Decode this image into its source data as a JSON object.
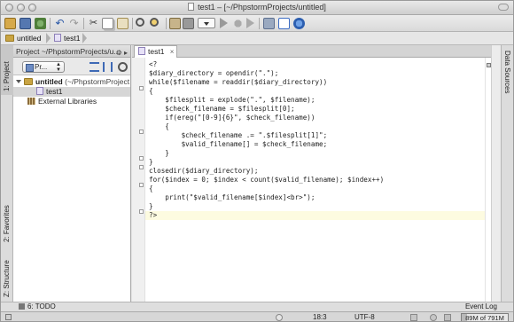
{
  "window": {
    "title": "test1 – [~/PhpstormProjects/untitled]"
  },
  "navbar": {
    "crumbs": [
      "untitled",
      "test1"
    ]
  },
  "left_stripe": {
    "tabs": [
      "1: Project",
      "2: Favorites",
      "Z: Structure"
    ]
  },
  "project_panel": {
    "header": "Project ~/PhpstormProjects/u...",
    "header_icons": "⚙ ▸",
    "view_select": "Pr...",
    "tree": [
      {
        "label": "untitled",
        "detail": "(~/PhpstormProject",
        "kind": "folder"
      },
      {
        "label": "test1",
        "kind": "file"
      },
      {
        "label": "External Libraries",
        "kind": "library"
      }
    ]
  },
  "editor": {
    "tab_label": "test1",
    "tab_close": "×",
    "lines": [
      "<?",
      "$diary_directory = opendir(\".\");",
      "while($filename = readdir($diary_directory))",
      "{",
      "    $filesplit = explode(\".\", $filename);",
      "    $check_filename = $filesplit[0];",
      "    if(ereg(\"[0-9]{6}\", $check_filename))",
      "    {",
      "        $check_filename .= \".$filesplit[1]\";",
      "        $valid_filename[] = $check_filename;",
      "    }",
      "}",
      "closedir($diary_directory);",
      "for($index = 0; $index < count($valid_filename); $index++)",
      "{",
      "    print(\"$valid_filename[$index]<br>\");",
      "}",
      "?>"
    ]
  },
  "right_stripe": {
    "tab": "Data Sources"
  },
  "bottom_bar": {
    "todo": "6: TODO",
    "event_log": "Event Log"
  },
  "status_bar": {
    "position": "18:3",
    "encoding": "UTF-8",
    "memory": "89M of 791M",
    "memory_used_fraction": 0.11
  }
}
